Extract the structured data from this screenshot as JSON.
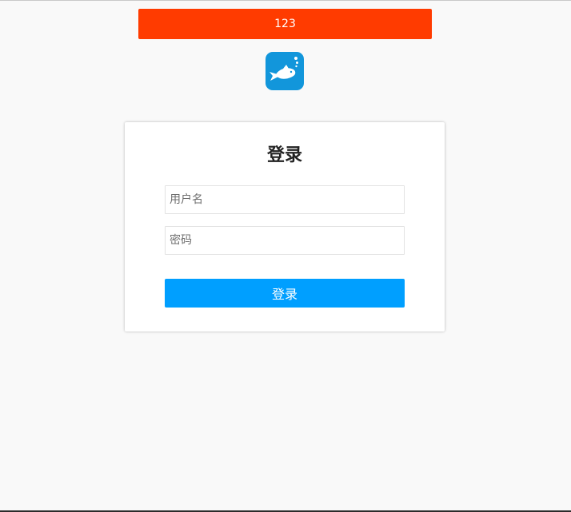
{
  "banner": {
    "text": "123",
    "color": "#ff3b00"
  },
  "logo": {
    "icon": "fish-icon",
    "background": "#1296db"
  },
  "login_card": {
    "title": "登录",
    "username_placeholder": "用户名",
    "password_placeholder": "密码",
    "submit_label": "登录",
    "submit_color": "#009fff"
  }
}
